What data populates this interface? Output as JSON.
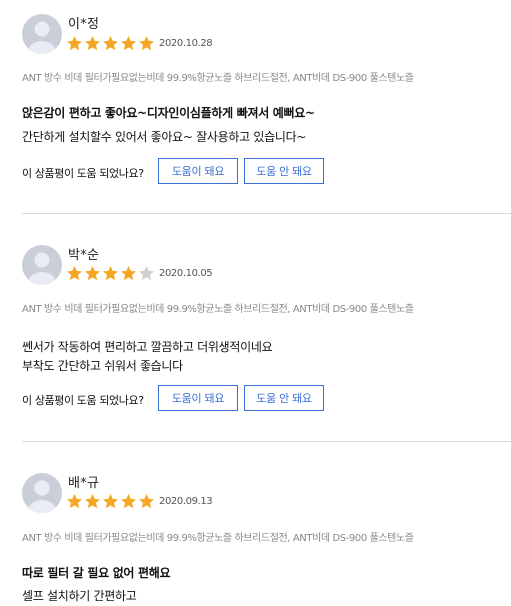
{
  "colors": {
    "star_filled": "#f5a623",
    "star_empty": "#cfcfcf",
    "button_accent": "#3b6fd6"
  },
  "helpful": {
    "question": "이 상품평이 도움 되었나요?",
    "yes_label": "도움이 돼요",
    "no_label": "도움 안 돼요"
  },
  "reviews": [
    {
      "user": "이*정",
      "rating": 5,
      "date": "2020.10.28",
      "product": "ANT 방수 비데 필터가필요없는비데 99.9%항균노즐 하브리드절전, ANT비데 DS-900 풀스텐노즐",
      "headline": "앉은감이 편하고 좋아요~디자인이심플하게 빠져서 예뻐요~",
      "body": [
        "간단하게 설치할수 있어서 좋아요~ 잘사용하고 있습니다~"
      ]
    },
    {
      "user": "박*순",
      "rating": 4,
      "date": "2020.10.05",
      "product": "ANT 방수 비데 필터가필요없는비데 99.9%항균노즐 하브리드절전, ANT비데 DS-900 풀스텐노즐",
      "headline": "",
      "body": [
        "쎈서가 작동하여 편리하고 깔끔하고 더위생적이네요",
        "부착도 간단하고 쉬워서 좋습니다"
      ]
    },
    {
      "user": "배*규",
      "rating": 5,
      "date": "2020.09.13",
      "product": "ANT 방수 비데 필터가필요없는비데 99.9%항균노즐 하브리드절전, ANT비데 DS-900 풀스텐노즐",
      "headline": "따로 필터 갈 필요 없어 편해요",
      "body": [
        "셀프 설치하기 간편하고"
      ]
    }
  ]
}
